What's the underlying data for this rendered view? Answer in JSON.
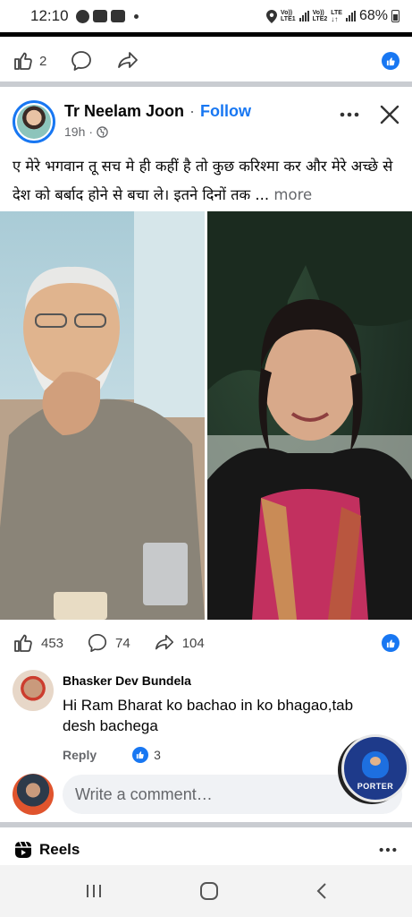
{
  "status_bar": {
    "time": "12:10",
    "net1_top": "Vo))",
    "net1_bottom": "LTE1",
    "net2_top": "Vo))",
    "net2_bottom": "LTE2",
    "lte": "LTE",
    "battery": "68%"
  },
  "prev_post": {
    "like_count": "2"
  },
  "post": {
    "author": "Tr Neelam Joon",
    "separator": "·",
    "follow_label": "Follow",
    "time": "19h",
    "time_sep": "·",
    "text": "ए मेरे भगवान तू सच मे ही कहीं है तो कुछ करिश्मा कर और मेरे अच्छे से देश को बर्बाद होने से बचा ले। इतने दिनों तक ...",
    "more_label": "more",
    "like_count": "453",
    "comment_count": "74",
    "share_count": "104"
  },
  "comment": {
    "author": "Bhasker Dev Bundela",
    "text": "Hi Ram Bharat ko bachao in ko bhagao,tab desh bachega",
    "reply_label": "Reply",
    "reaction_count": "3"
  },
  "porter_badge": {
    "label": "PORTER"
  },
  "write_comment": {
    "placeholder": "Write a comment…"
  },
  "reels": {
    "label": "Reels"
  },
  "colors": {
    "facebook_blue": "#1877f2",
    "divider_gray": "#c9ccd1",
    "secondary_text": "#65676b"
  }
}
